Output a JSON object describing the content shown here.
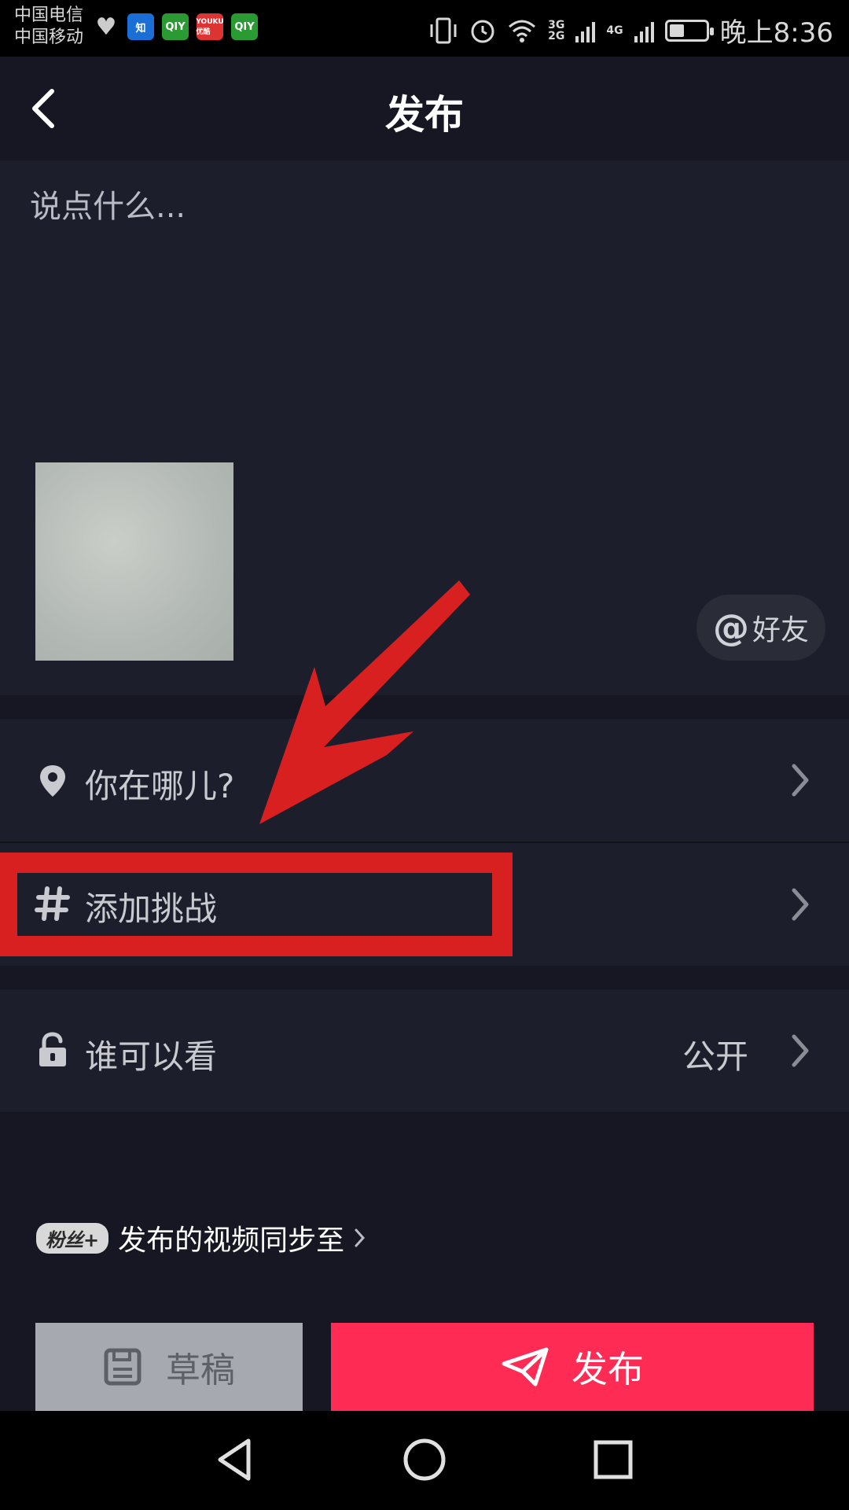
{
  "status_bar": {
    "carrier_1": "中国电信",
    "carrier_2": "中国移动",
    "app_icons": [
      "health-icon",
      "zhihu-icon",
      "iqiyi-icon",
      "youku-icon",
      "iqiyi-icon"
    ],
    "zhihu_label": "知",
    "iqiyi_label": "QIY",
    "youku_label": "YOUKU 优酷",
    "network_1": "3G",
    "network_2": "2G",
    "network_3": "4G",
    "time": "晚上8:36"
  },
  "header": {
    "title": "发布",
    "back_icon": "chevron-left-icon"
  },
  "caption": {
    "placeholder": "说点什么..."
  },
  "mention": {
    "at": "@",
    "label": "好友"
  },
  "rows": {
    "location": {
      "label": "你在哪儿?",
      "icon": "location-pin-icon"
    },
    "challenge": {
      "label": "添加挑战",
      "icon": "hashtag-icon"
    },
    "visibility": {
      "label": "谁可以看",
      "value": "公开",
      "icon": "lock-icon"
    }
  },
  "sync": {
    "badge": "粉丝+",
    "label": "发布的视频同步至"
  },
  "actions": {
    "draft_label": "草稿",
    "publish_label": "发布"
  },
  "colors": {
    "accent": "#fe2c55",
    "annotation": "#d92020",
    "background": "#161722",
    "panel": "#1c1f2b"
  }
}
